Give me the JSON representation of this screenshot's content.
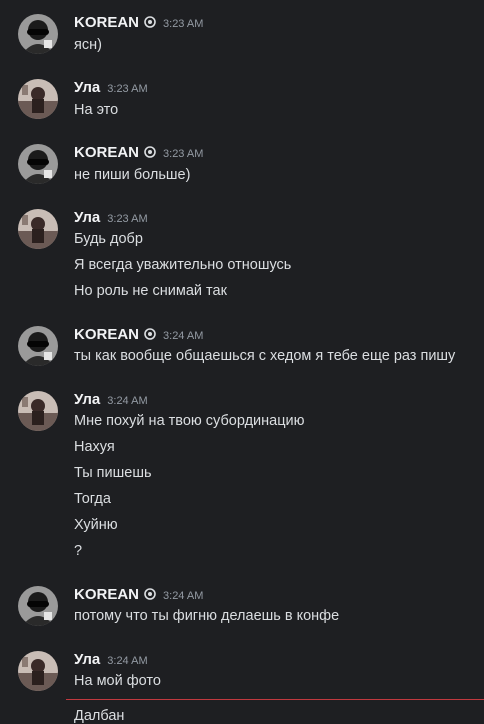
{
  "colors": {
    "background": "#1e1f22",
    "name": "#f2f3f5",
    "text": "#dbdee1",
    "timestamp": "#949ba4",
    "new_divider": "#c0393f"
  },
  "messages": [
    {
      "author": "KOREAN",
      "badge": "shield-icon",
      "time": "3:23 AM",
      "avatar": "korean",
      "lines": [
        "ясн)"
      ]
    },
    {
      "author": "Ула",
      "time": "3:23 AM",
      "avatar": "ula",
      "lines": [
        "На это"
      ]
    },
    {
      "author": "KOREAN",
      "badge": "shield-icon",
      "time": "3:23 AM",
      "avatar": "korean",
      "lines": [
        "не пиши больше)"
      ]
    },
    {
      "author": "Ула",
      "time": "3:23 AM",
      "avatar": "ula",
      "lines": [
        "Будь добр",
        "Я всегда уважительно отношусь",
        "Но роль не снимай так"
      ]
    },
    {
      "author": "KOREAN",
      "badge": "shield-icon",
      "time": "3:24 AM",
      "avatar": "korean",
      "lines": [
        "ты как вообще общаешься с хедом я тебе еще раз пишу"
      ]
    },
    {
      "author": "Ула",
      "time": "3:24 AM",
      "avatar": "ula",
      "lines": [
        "Мне похуй на твою субординацию",
        "Нахуя",
        "Ты пишешь",
        "Тогда",
        "Хуйню",
        "?"
      ]
    },
    {
      "author": "KOREAN",
      "badge": "shield-icon",
      "time": "3:24 AM",
      "avatar": "korean",
      "lines": [
        "потому что ты фигню делаешь в конфе"
      ]
    },
    {
      "author": "Ула",
      "time": "3:24 AM",
      "avatar": "ula",
      "lines": [
        "На мой фото"
      ]
    }
  ],
  "after_divider": {
    "lines": [
      "Далбан"
    ]
  }
}
